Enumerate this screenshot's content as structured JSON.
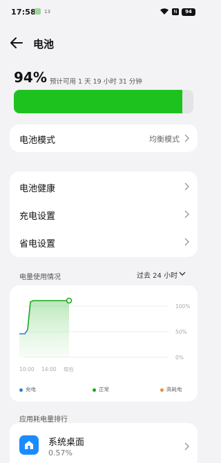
{
  "status_bar": {
    "time": "17:58",
    "notification_text": "13",
    "battery_level": "94"
  },
  "header": {
    "title": "电池",
    "back_icon": "arrow-left-icon"
  },
  "battery": {
    "percent_text": "94%",
    "estimate": "预计可用 1 天 19 小时 31 分钟",
    "level_fraction": 0.94,
    "fill_color": "#1ec21e"
  },
  "battery_mode": {
    "label": "电池模式",
    "value": "均衡模式"
  },
  "settings_menu": {
    "items": [
      {
        "label": "电池健康"
      },
      {
        "label": "充电设置"
      },
      {
        "label": "省电设置"
      }
    ]
  },
  "usage": {
    "section_label": "电量使用情况",
    "range_label": "过去 24 小时",
    "y_ticks": [
      "100%",
      "50%",
      "0%"
    ],
    "x_ticks": [
      "10:00",
      "14:00",
      "现在"
    ],
    "legend": [
      {
        "label": "充电",
        "color": "#2a7fdc"
      },
      {
        "label": "正常",
        "color": "#1ea51e"
      },
      {
        "label": "高耗电",
        "color": "#e8902a"
      }
    ]
  },
  "ranking": {
    "section_label": "应用耗电量排行",
    "apps": [
      {
        "name": "系统桌面",
        "percent": "0.57%"
      }
    ]
  }
}
